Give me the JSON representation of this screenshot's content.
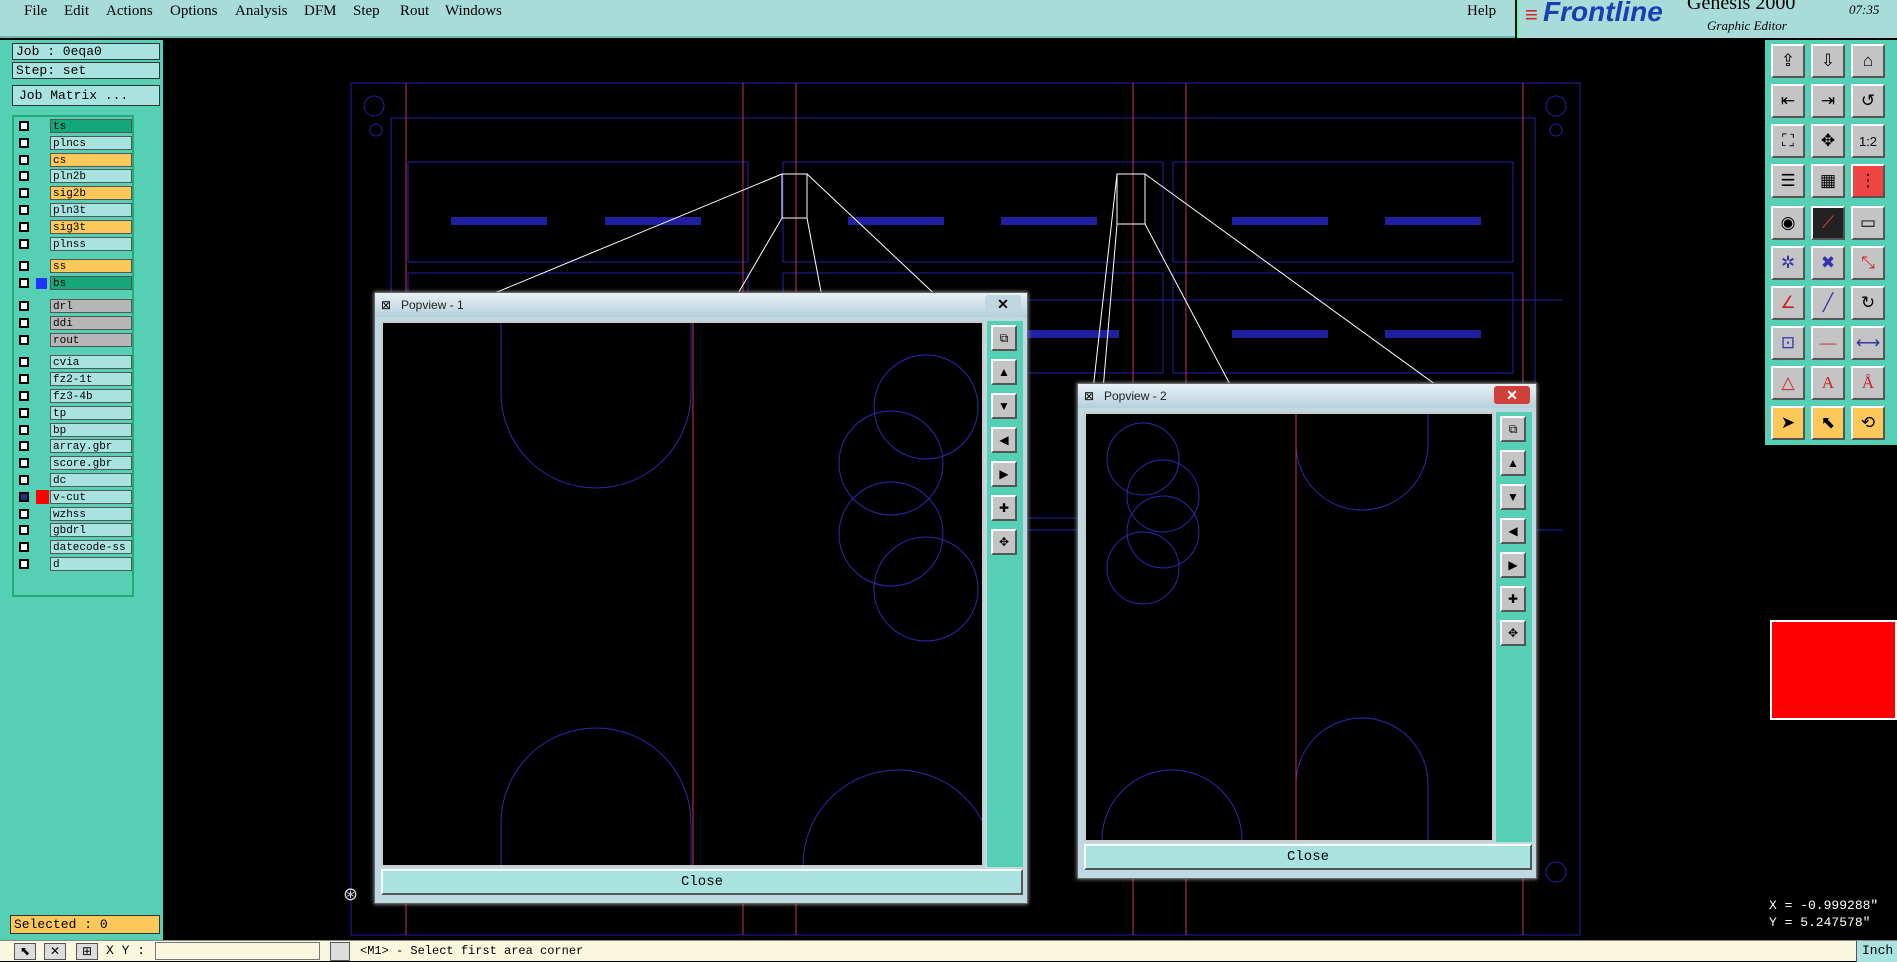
{
  "menubar": {
    "items": [
      "File",
      "Edit",
      "Actions",
      "Options",
      "Analysis",
      "DFM",
      "Step",
      "Rout",
      "Windows"
    ],
    "help": "Help"
  },
  "brand": {
    "logo_text": "Frontline",
    "product": "Genesis 2000",
    "subtitle": "Graphic Editor",
    "time": "07:35"
  },
  "job": {
    "job_label": "Job : 0eqa0",
    "step_label": "Step: set",
    "matrix_button": "Job Matrix ..."
  },
  "layers": [
    {
      "name": "ts",
      "color": "#13a77a"
    },
    {
      "name": "plncs",
      "color": "#a9e3df"
    },
    {
      "name": "cs",
      "color": "#fdc85a"
    },
    {
      "name": "pln2b",
      "color": "#a9e3df"
    },
    {
      "name": "sig2b",
      "color": "#fdc85a"
    },
    {
      "name": "pln3t",
      "color": "#a9e3df"
    },
    {
      "name": "sig3t",
      "color": "#fdc85a"
    },
    {
      "name": "plnss",
      "color": "#a9e3df"
    },
    {
      "name": "ss",
      "color": "#fdc85a"
    },
    {
      "name": "bs",
      "color": "#13a77a"
    },
    {
      "name": "drl",
      "color": "#b7b7b7"
    },
    {
      "name": "ddi",
      "color": "#b7b7b7"
    },
    {
      "name": "rout",
      "color": "#b7b7b7"
    },
    {
      "name": "cvia",
      "color": "#a9e3df"
    },
    {
      "name": "fz2-1t",
      "color": "#a9e3df"
    },
    {
      "name": "fz3-4b",
      "color": "#a9e3df"
    },
    {
      "name": "tp",
      "color": "#a9e3df"
    },
    {
      "name": "bp",
      "color": "#a9e3df"
    },
    {
      "name": "array.gbr",
      "color": "#a9e3df"
    },
    {
      "name": "score.gbr",
      "color": "#a9e3df"
    },
    {
      "name": "dc",
      "color": "#a9e3df"
    },
    {
      "name": "v-cut",
      "color": "#a9e3df"
    },
    {
      "name": "wzhss",
      "color": "#a9e3df"
    },
    {
      "name": "gbdrl",
      "color": "#a9e3df"
    },
    {
      "name": "datecode-ss",
      "color": "#a9e3df"
    },
    {
      "name": "d",
      "color": "#a9e3df"
    }
  ],
  "selected": "Selected : 0",
  "popview1": {
    "title": "Popview - 1",
    "close_label": "Close"
  },
  "popview2": {
    "title": "Popview - 2",
    "close_label": "Close"
  },
  "coords": {
    "x": "X = -0.999288\"",
    "y": "Y = 5.247578\""
  },
  "status": {
    "xy_label": "X Y :",
    "message": "<M1> - Select first area corner",
    "units": "Inch"
  },
  "tools": [
    "1:2"
  ]
}
